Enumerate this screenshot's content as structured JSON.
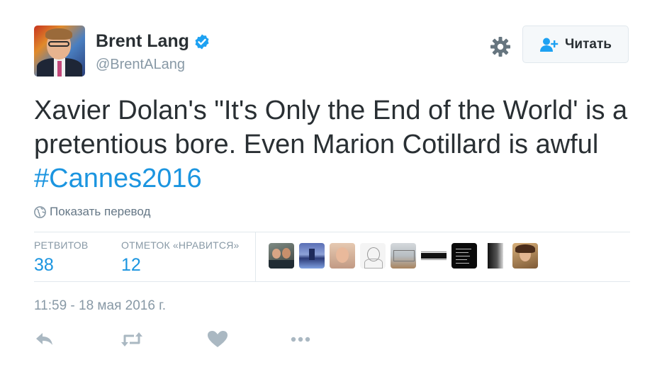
{
  "user": {
    "name": "Brent Lang",
    "handle": "@BrentALang"
  },
  "follow_button": {
    "label": "Читать"
  },
  "tweet": {
    "text_before": "Xavier Dolan's \"It's Only the End of the World' is a pretentious bore. Even Marion Cotillard is awful  ",
    "hashtag": "#Cannes2016"
  },
  "translate": {
    "label": "Показать перевод"
  },
  "stats": {
    "retweets_label": "РЕТВИТОВ",
    "retweets_value": "38",
    "likes_label": "ОТМЕТОК «НРАВИТСЯ»",
    "likes_value": "12"
  },
  "timestamp": "11:59 - 18 мая 2016 г.",
  "colors": {
    "link": "#1b95e0",
    "text": "#292f33",
    "muted": "#8899a6",
    "icon": "#aab8c2"
  }
}
